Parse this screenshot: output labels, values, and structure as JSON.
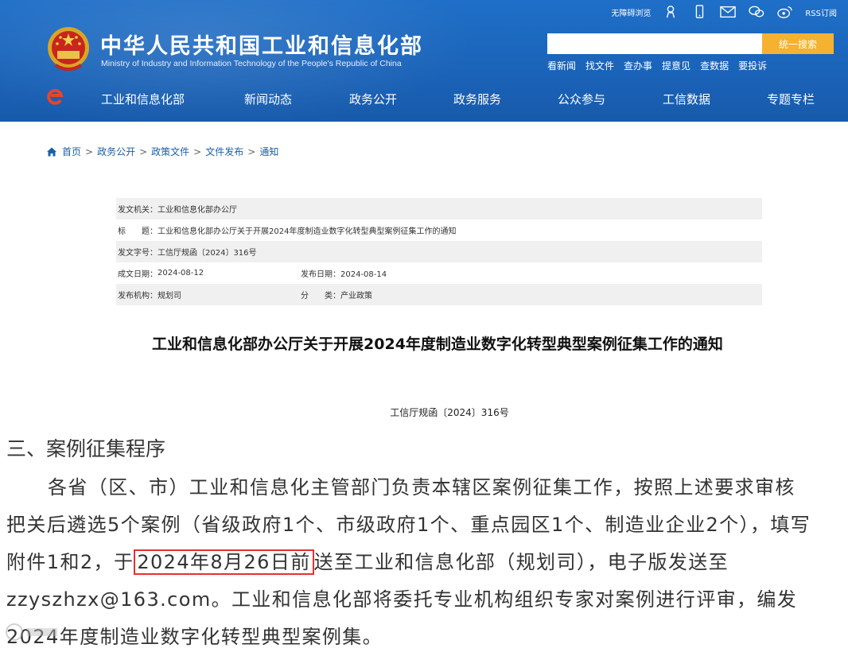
{
  "header": {
    "title_cn": "中华人民共和国工业和信息化部",
    "title_en": "Ministry of Industry and Information Technology of the People's Republic of China",
    "topbar": {
      "accessibility": "无障碍浏览",
      "rss": "RSS订阅",
      "icons": [
        "robot-icon",
        "mobile-icon",
        "mail-icon",
        "wechat-icon",
        "weibo-icon"
      ]
    },
    "search": {
      "placeholder": "",
      "button_label": "统一搜索"
    },
    "quicklinks": [
      "看新闻",
      "找文件",
      "查办事",
      "提意见",
      "查数据",
      "要投诉"
    ],
    "nav": [
      "工业和信息化部",
      "新闻动态",
      "政务公开",
      "政务服务",
      "公众参与",
      "工信数据",
      "专题专栏"
    ],
    "colors": {
      "header_bg": "#1f6fc8",
      "search_button": "#f5b230"
    }
  },
  "breadcrumb": [
    "首页",
    "政务公开",
    "政策文件",
    "文件发布",
    "通知"
  ],
  "meta": {
    "issuer_label": "发文机关：",
    "issuer": "工业和信息化部办公厅",
    "title_label": "标　　题：",
    "title": "工业和信息化部办公厅关于开展2024年度制造业数字化转型典型案例征集工作的通知",
    "docno_label": "发文字号：",
    "docno": "工信厅规函〔2024〕316号",
    "written_label": "成文日期：",
    "written": "2024-08-12",
    "published_label": "发布日期：",
    "published": "2024-08-14",
    "org_label": "发布机构：",
    "org": "规划司",
    "category_label": "分　　类：",
    "category": "产业政策"
  },
  "document": {
    "title": "工业和信息化部办公厅关于开展2024年度制造业数字化转型典型案例征集工作的通知",
    "number": "工信厅规函〔2024〕316号",
    "section_head": "三、案例征集程序",
    "lines": [
      "各省（区、市）工业和信息化主管部门负责本辖区案例征集工作，按照上述要求审核",
      "把关后遴选5个案例（省级政府1个、市级政府1个、重点园区1个、制造业企业2个），填写",
      "附件1和2，于",
      "2024年8月26日前",
      "送至工业和信息化部（规划司），电子版发送至",
      "zzyszhzx@163.com。工业和信息化部将委托专业机构组织专家对案例进行评审，编发",
      "2024年度制造业数字化转型典型案例集。"
    ],
    "highlight_color": "#e53030"
  }
}
